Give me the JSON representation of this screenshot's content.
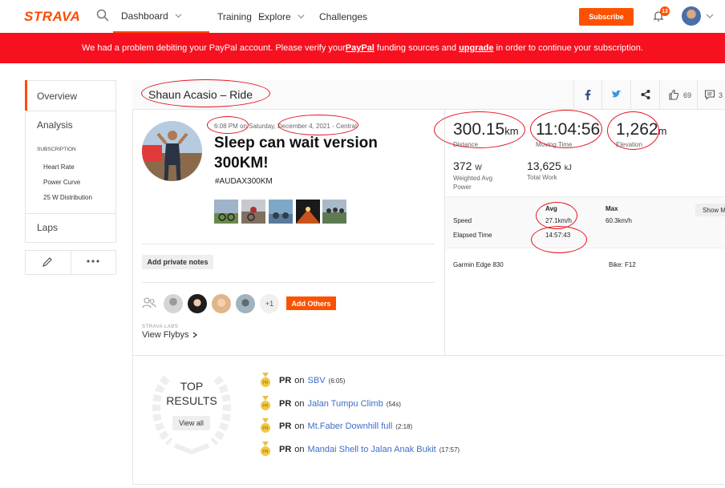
{
  "header": {
    "logo": "STRAVA",
    "nav": [
      "Dashboard",
      "Training",
      "Explore",
      "Challenges"
    ],
    "subscribe_label": "Subscribe",
    "notification_count": "13"
  },
  "banner": {
    "text_1": "We had a problem debiting your PayPal account. Please verify your ",
    "link_1": "PayPal",
    "text_2": " funding sources and ",
    "link_2": "upgrade",
    "text_3": " in order to continue your subscription."
  },
  "sidebar": {
    "overview": "Overview",
    "analysis": "Analysis",
    "subscription_label": "SUBSCRIPTION",
    "sub_items": [
      "Heart Rate",
      "Power Curve",
      "25 W Distribution"
    ],
    "laps": "Laps"
  },
  "activity": {
    "athlete_title": "Shaun Acasio – Ride",
    "kudos_count": "69",
    "comment_count": "3",
    "time": "6:08 PM",
    "on_text": " on Saturday, ",
    "date": "December 4, 2021",
    "location": " - Central",
    "name": "Sleep can wait version 300KM!",
    "hashtag": "#AUDAX300KM",
    "private_notes_label": "Add private notes",
    "others_more": "+1",
    "add_others_label": "Add Others",
    "labs_label": "STRAVA LABS",
    "flyby_label": "View Flybys"
  },
  "stats": {
    "distance": {
      "value": "300.15",
      "unit": "km",
      "label": "Distance"
    },
    "moving_time": {
      "value": "11:04:56",
      "label": "Moving Time"
    },
    "elevation": {
      "value": "1,262",
      "unit": "m",
      "label": "Elevation"
    },
    "power": {
      "value": "372",
      "unit": "W",
      "label": "Weighted Avg Power"
    },
    "work": {
      "value": "13,625",
      "unit": "kJ",
      "label": "Total Work"
    },
    "table_headers": [
      "Avg",
      "Max"
    ],
    "speed": {
      "label": "Speed",
      "avg": "27.1km/h",
      "max": "60.3km/h"
    },
    "elapsed": {
      "label": "Elapsed Time",
      "value": "14:57:43"
    },
    "show_more": "Show M",
    "device": "Garmin Edge 830",
    "bike": "Bike: F12"
  },
  "results": {
    "top": "TOP",
    "results": "RESULTS",
    "view_all": "View all",
    "pr_label": "PR",
    "on": "on",
    "segments": [
      {
        "name": "SBV",
        "time": "(6:05)"
      },
      {
        "name": "Jalan Tumpu Climb",
        "time": "(54s)"
      },
      {
        "name": "Mt.Faber Downhill full",
        "time": "(2:18)"
      },
      {
        "name": "Mandai Shell to Jalan Anak Bukit",
        "time": "(17:57)"
      }
    ]
  },
  "colors": {
    "brand": "#fc4c02",
    "banner": "#f7101f",
    "annotation": "#e3141d",
    "link": "#3d6ec9"
  }
}
